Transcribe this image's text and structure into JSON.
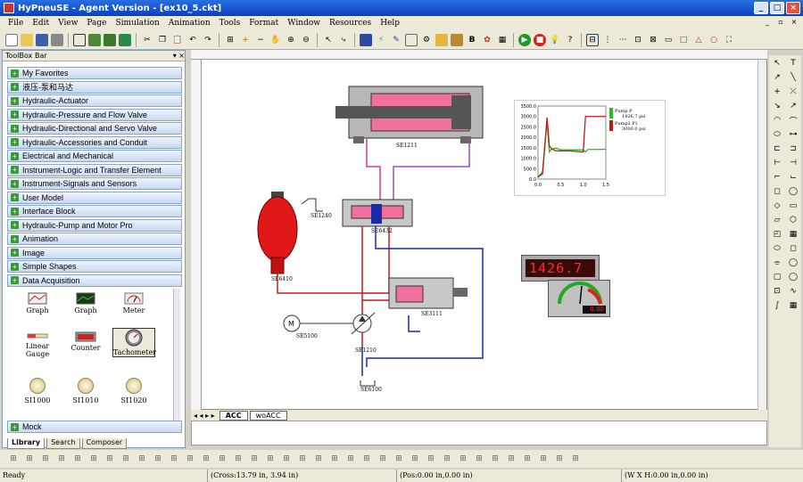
{
  "window": {
    "title": "HyPneuSE - Agent Version - [ex10_5.ckt]"
  },
  "menu": [
    "File",
    "Edit",
    "View",
    "Page",
    "Simulation",
    "Animation",
    "Tools",
    "Format",
    "Window",
    "Resources",
    "Help"
  ],
  "toolbox": {
    "title": "ToolBox Bar",
    "categories": [
      "My Favorites",
      "液压-泵和马达",
      "Hydraulic-Actuator",
      "Hydraulic-Pressure and Flow Valve",
      "Hydraulic-Directional and Servo Valve",
      "Hydraulic-Accessories and Conduit",
      "Electrical and Mechanical",
      "Instrument-Logic and Transfer Element",
      "Instrument-Signals and Sensors",
      "User Model",
      "Interface Block",
      "Hydraulic-Pump and Motor Pro",
      "Animation",
      "Image",
      "Simple Shapes",
      "Data Acquisition"
    ],
    "components": [
      "Graph",
      "Graph",
      "Meter",
      "Linear Gauge",
      "Counter",
      "Tachometer",
      "SI1000",
      "SI1010",
      "SI1020"
    ],
    "footer_category": "Mock",
    "tabs": [
      "Library",
      "Search",
      "Composer"
    ]
  },
  "canvas": {
    "labels": {
      "cyl": "SE1211",
      "valve": "SE6432",
      "acc": "SE6410",
      "valve2": "SE3111",
      "motor": "SE5100",
      "pump": "SE1210",
      "tank": "SE6100",
      "sig": "SE1240"
    },
    "counter_value": "1426.7",
    "meter_value": "0.00",
    "sheets": [
      "ACC",
      "woACC"
    ]
  },
  "chart_data": {
    "type": "line",
    "x": [
      0,
      0.1,
      0.2,
      0.25,
      0.3,
      0.4,
      0.5,
      0.7,
      1.0,
      1.05,
      1.1,
      1.5
    ],
    "series": [
      {
        "name": "Pump P",
        "value_label": "1426.7 psi",
        "color": "#22c022",
        "values": [
          100,
          350,
          2750,
          1300,
          1450,
          1480,
          1400,
          1400,
          1400,
          1300,
          1420,
          1426.7
        ]
      },
      {
        "name": "Pump2 P1",
        "value_label": "3000.0 psi",
        "color": "#c01818",
        "values": [
          100,
          250,
          2950,
          1600,
          1450,
          1350,
          1350,
          1350,
          1300,
          3000,
          3000,
          3000
        ]
      }
    ],
    "yticks": [
      "3500.0",
      "3000.0",
      "2500.0",
      "2000.0",
      "1500.0",
      "1000.0",
      "500.0",
      "0.0"
    ],
    "xticks": [
      "0.0",
      "0.5",
      "1.0",
      "1.5"
    ],
    "ylim": [
      0,
      3500
    ],
    "xlim": [
      0,
      1.5
    ]
  },
  "status": {
    "ready": "Ready",
    "cross": "(Cross:13.79 in, 3.94 in)",
    "pos": "(Pos:0.00 in,0.00 in)",
    "size": "(W X H:0.00 in,0.00 in)"
  }
}
